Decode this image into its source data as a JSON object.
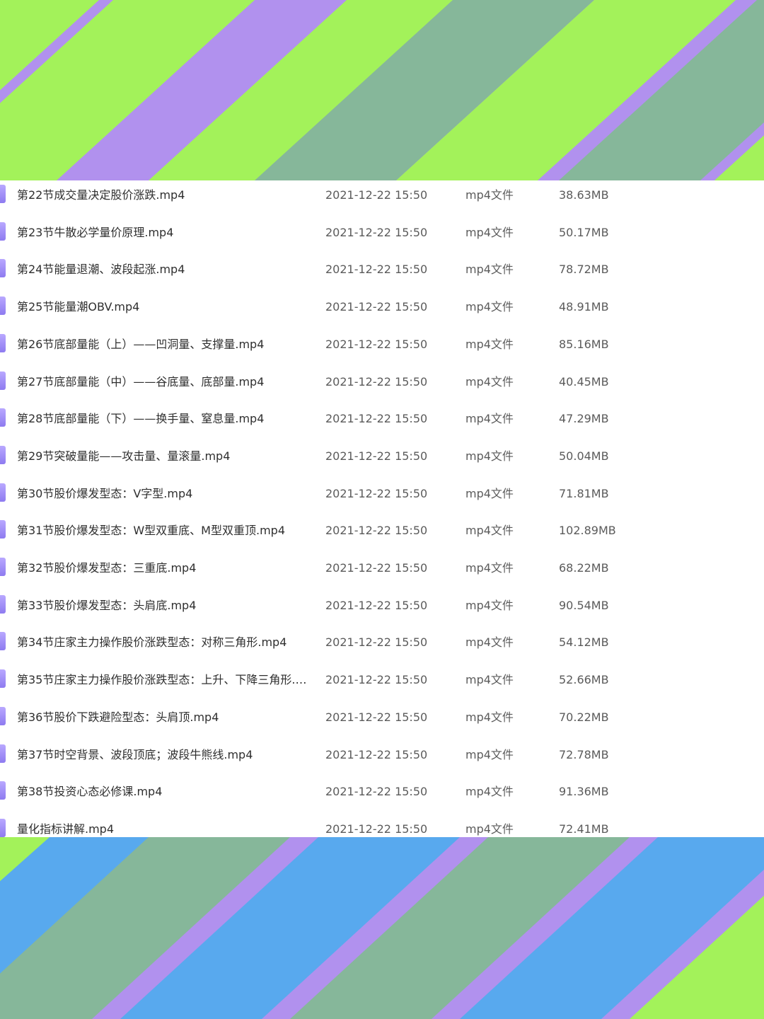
{
  "colors": {
    "purple": "#b191ee",
    "green": "#a3f25a",
    "teal": "#86b79a",
    "blue": "#58a9ee",
    "icon": "#9b88f7"
  },
  "icon_names": {
    "file": "video-file-icon"
  },
  "files": [
    {
      "name": "第22节成交量决定股价涨跌.mp4",
      "date": "2021-12-22 15:50",
      "type": "mp4文件",
      "size": "38.63MB"
    },
    {
      "name": "第23节牛散必学量价原理.mp4",
      "date": "2021-12-22 15:50",
      "type": "mp4文件",
      "size": "50.17MB"
    },
    {
      "name": "第24节能量退潮、波段起涨.mp4",
      "date": "2021-12-22 15:50",
      "type": "mp4文件",
      "size": "78.72MB"
    },
    {
      "name": "第25节能量潮OBV.mp4",
      "date": "2021-12-22 15:50",
      "type": "mp4文件",
      "size": "48.91MB"
    },
    {
      "name": "第26节底部量能（上）——凹洞量、支撑量.mp4",
      "date": "2021-12-22 15:50",
      "type": "mp4文件",
      "size": "85.16MB"
    },
    {
      "name": "第27节底部量能（中）——谷底量、底部量.mp4",
      "date": "2021-12-22 15:50",
      "type": "mp4文件",
      "size": "40.45MB"
    },
    {
      "name": "第28节底部量能（下）——换手量、窒息量.mp4",
      "date": "2021-12-22 15:50",
      "type": "mp4文件",
      "size": "47.29MB"
    },
    {
      "name": "第29节突破量能——攻击量、量滚量.mp4",
      "date": "2021-12-22 15:50",
      "type": "mp4文件",
      "size": "50.04MB"
    },
    {
      "name": "第30节股价爆发型态：V字型.mp4",
      "date": "2021-12-22 15:50",
      "type": "mp4文件",
      "size": "71.81MB"
    },
    {
      "name": "第31节股价爆发型态：W型双重底、M型双重顶.mp4",
      "date": "2021-12-22 15:50",
      "type": "mp4文件",
      "size": "102.89MB"
    },
    {
      "name": "第32节股价爆发型态：三重底.mp4",
      "date": "2021-12-22 15:50",
      "type": "mp4文件",
      "size": "68.22MB"
    },
    {
      "name": "第33节股价爆发型态：头肩底.mp4",
      "date": "2021-12-22 15:50",
      "type": "mp4文件",
      "size": "90.54MB"
    },
    {
      "name": "第34节庄家主力操作股价涨跌型态：对称三角形.mp4",
      "date": "2021-12-22 15:50",
      "type": "mp4文件",
      "size": "54.12MB"
    },
    {
      "name": "第35节庄家主力操作股价涨跌型态：上升、下降三角形.m...",
      "date": "2021-12-22 15:50",
      "type": "mp4文件",
      "size": "52.66MB"
    },
    {
      "name": "第36节股价下跌避险型态：头肩顶.mp4",
      "date": "2021-12-22 15:50",
      "type": "mp4文件",
      "size": "70.22MB"
    },
    {
      "name": "第37节时空背景、波段顶底；波段牛熊线.mp4",
      "date": "2021-12-22 15:50",
      "type": "mp4文件",
      "size": "72.78MB"
    },
    {
      "name": "第38节投资心态必修课.mp4",
      "date": "2021-12-22 15:50",
      "type": "mp4文件",
      "size": "91.36MB"
    },
    {
      "name": "量化指标讲解.mp4",
      "date": "2021-12-22 15:50",
      "type": "mp4文件",
      "size": "72.41MB"
    }
  ]
}
